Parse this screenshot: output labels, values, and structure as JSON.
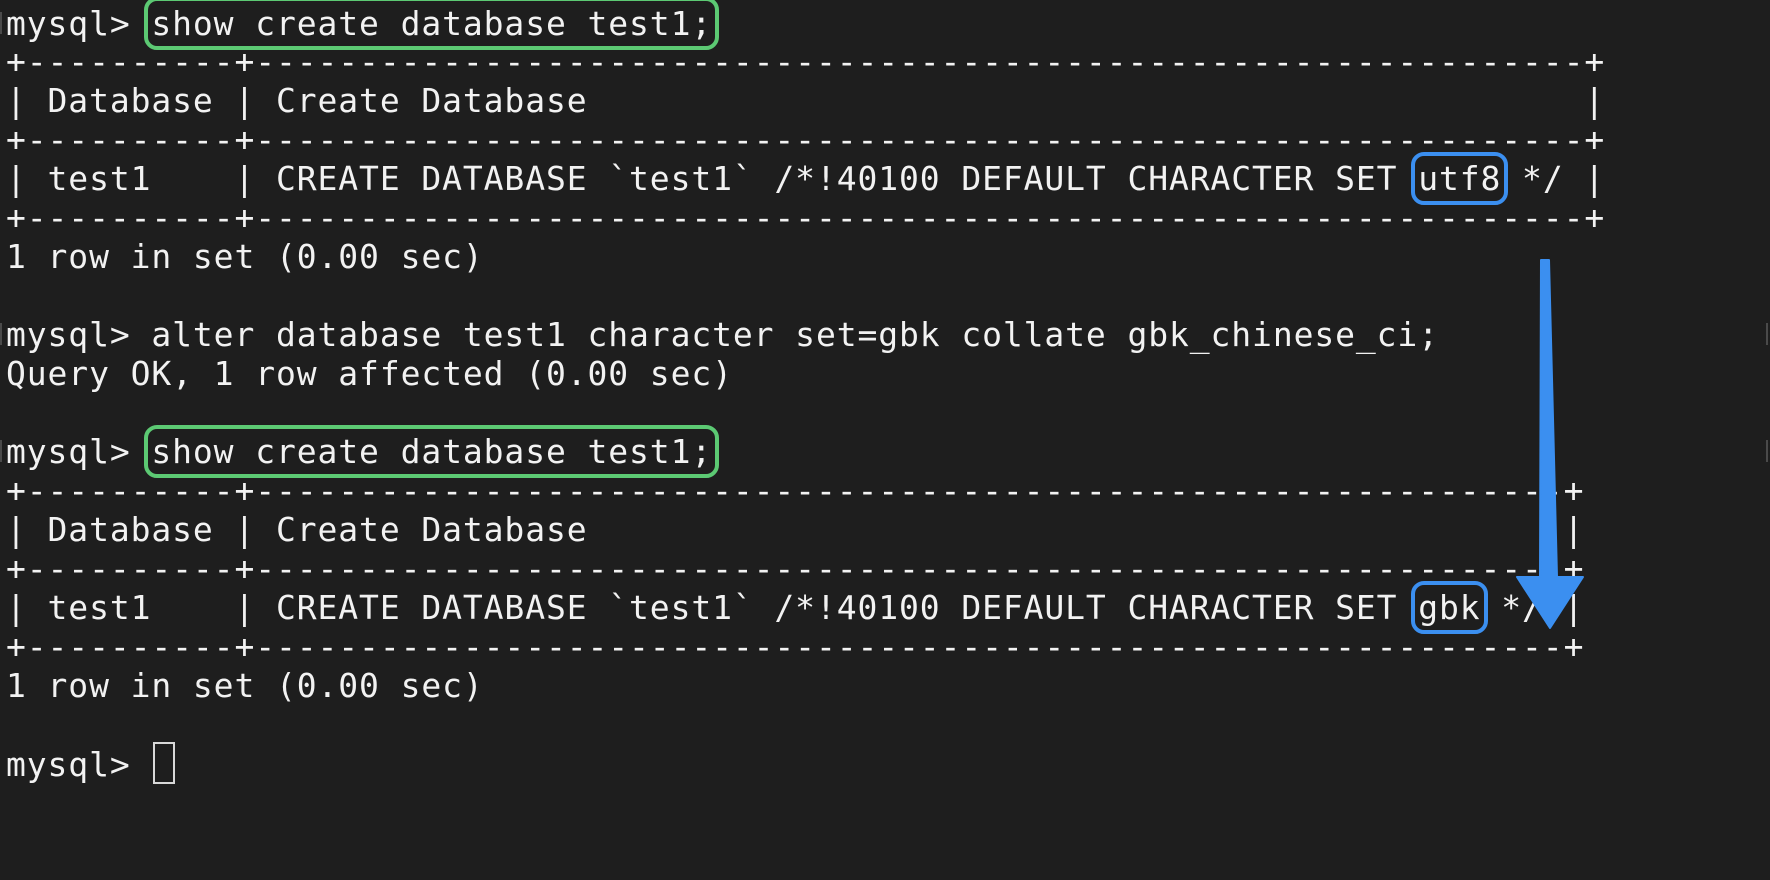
{
  "terminal": {
    "prompt": "mysql> ",
    "block1": {
      "command": "show create database test1;",
      "border": "+----------+----------------------------------------------------------------+",
      "header": "| Database | Create Database                                                |",
      "row_prefix": "| test1    | CREATE DATABASE `test1` /*!40100 DEFAULT CHARACTER SET ",
      "charset": "utf8",
      "row_suffix": " */ |",
      "result": "1 row in set (0.00 sec)"
    },
    "alter": {
      "command": "alter database test1 character set=gbk collate gbk_chinese_ci;",
      "result": "Query OK, 1 row affected (0.00 sec)"
    },
    "block2": {
      "command": "show create database test1;",
      "border": "+----------+---------------------------------------------------------------+",
      "header": "| Database | Create Database                                               |",
      "row_prefix": "| test1    | CREATE DATABASE `test1` /*!40100 DEFAULT CHARACTER SET ",
      "charset": "gbk",
      "row_suffix": " */ |",
      "result": "1 row in set (0.00 sec)"
    }
  },
  "colors": {
    "background": "#1e1e1e",
    "text": "#f2f2f2",
    "command_highlight": "#5cc973",
    "value_highlight": "#3b8ff0",
    "arrow": "#3b8ff0"
  },
  "icons": {
    "cursor": "block-cursor",
    "arrow": "down-arrow-icon"
  }
}
